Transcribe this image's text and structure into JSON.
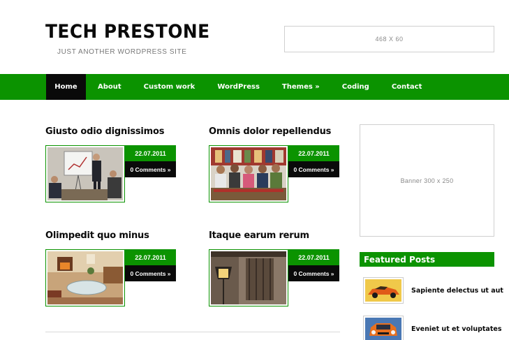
{
  "header": {
    "site_title": "TECH PRESTONE",
    "tagline": "JUST ANOTHER WORDPRESS SITE",
    "ad_label": "468 X 60"
  },
  "nav": {
    "items": [
      {
        "label": "Home"
      },
      {
        "label": "About"
      },
      {
        "label": "Custom work"
      },
      {
        "label": "WordPress"
      },
      {
        "label": "Themes »"
      },
      {
        "label": "Coding"
      },
      {
        "label": "Contact"
      }
    ]
  },
  "posts": [
    {
      "title": "Giusto odio dignissimos",
      "date": "22.07.2011",
      "comments": "0 Comments »",
      "image": "meeting-photo"
    },
    {
      "title": "Omnis dolor repellendus",
      "date": "22.07.2011",
      "comments": "0 Comments »",
      "image": "students-library-photo"
    },
    {
      "title": "Olimpedit quo minus",
      "date": "22.07.2011",
      "comments": "0 Comments »",
      "image": "living-room-photo"
    },
    {
      "title": "Itaque earum rerum",
      "date": "22.07.2011",
      "comments": "0 Comments »",
      "image": "street-lamp-photo"
    }
  ],
  "sidebar": {
    "banner_label": "Banner  300 x 250",
    "featured_title": "Featured Posts",
    "featured": [
      {
        "title": "Sapiente delectus ut aut",
        "image": "orange-car-photo"
      },
      {
        "title": "Eveniet ut et voluptates",
        "image": "orange-car-front-photo"
      }
    ]
  },
  "colors": {
    "accent_green": "#0b9300",
    "dark": "#0a0a0a"
  }
}
